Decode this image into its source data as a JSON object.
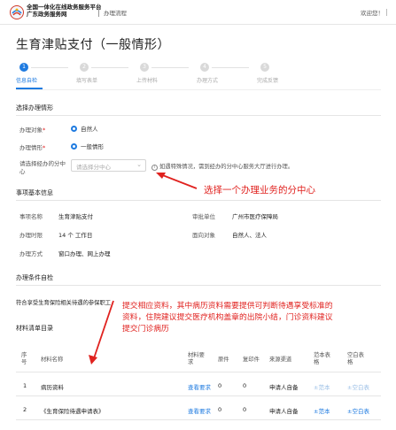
{
  "header": {
    "brand_line1": "全国一体化在线政务服务平台",
    "brand_line2": "广东政务服务网",
    "subtitle": "办理流程",
    "user_text": "欢迎您！"
  },
  "page_title": "生育津贴支付（一般情形）",
  "steps": [
    {
      "num": "1",
      "label": "信息自检",
      "active": true
    },
    {
      "num": "2",
      "label": "填写表单",
      "active": false
    },
    {
      "num": "3",
      "label": "上传材料",
      "active": false
    },
    {
      "num": "4",
      "label": "办理方式",
      "active": false
    },
    {
      "num": "5",
      "label": "完成反馈",
      "active": false
    }
  ],
  "choose_section": {
    "title": "选择办理情形",
    "object_label": "办理对象",
    "object_value": "自然人",
    "situation_label": "办理情形",
    "situation_value": "一般情形",
    "center_label_line1": "请选择经办的分中",
    "center_label_line2": "心",
    "center_placeholder": "请选择分中心",
    "center_hint": "如遇特殊情况，需到经办的分中心服务大厅进行办理。"
  },
  "annotation_center": "选择一个办理业务的分中心",
  "basic_info": {
    "title": "事项基本信息",
    "rows": [
      {
        "l1": "事项名称",
        "v1": "生育津贴支付",
        "l2": "审批单位",
        "v2": "广州市医疗保障局"
      },
      {
        "l1": "办理时限",
        "v1": "14 个 工作日",
        "l2": "面向对象",
        "v2": "自然人、法人"
      },
      {
        "l1": "办理方式",
        "v1": "窗口办理、网上办理",
        "l2": "",
        "v2": ""
      }
    ]
  },
  "conditions": {
    "title": "办理条件自检",
    "text": "符合享受生育保险相关待遇的参保职工"
  },
  "annotation_materials": [
    "提交相应资料，其中病历资料需要提供可判断待遇享受标准的",
    "资料，住院建议提交医疗机构盖章的出院小结，门诊资料建议",
    "提交门诊病历"
  ],
  "materials": {
    "title": "材料清单目录",
    "headers": {
      "no_1": "序",
      "no_2": "号",
      "name": "材料名称",
      "req_1": "材料要",
      "req_2": "求",
      "orig": "原件",
      "copy": "复印件",
      "source": "来源渠道",
      "sample_1": "范本表",
      "sample_2": "格",
      "blank_1": "空白表",
      "blank_2": "格"
    },
    "rows": [
      {
        "no": "1",
        "name": "病历资料",
        "req": "查看要求",
        "orig": "0",
        "copy": "0",
        "source": "申请人自备",
        "sample": "±范本",
        "blank": "±空白表"
      },
      {
        "no": "2",
        "name": "《生育保险待遇申请表》",
        "req": "查看要求",
        "orig": "0",
        "copy": "0",
        "source": "申请人自备",
        "sample": "±范本",
        "blank": "±空白表"
      }
    ]
  },
  "colors": {
    "accent": "#1f7be0",
    "annotation": "#e0221f"
  }
}
